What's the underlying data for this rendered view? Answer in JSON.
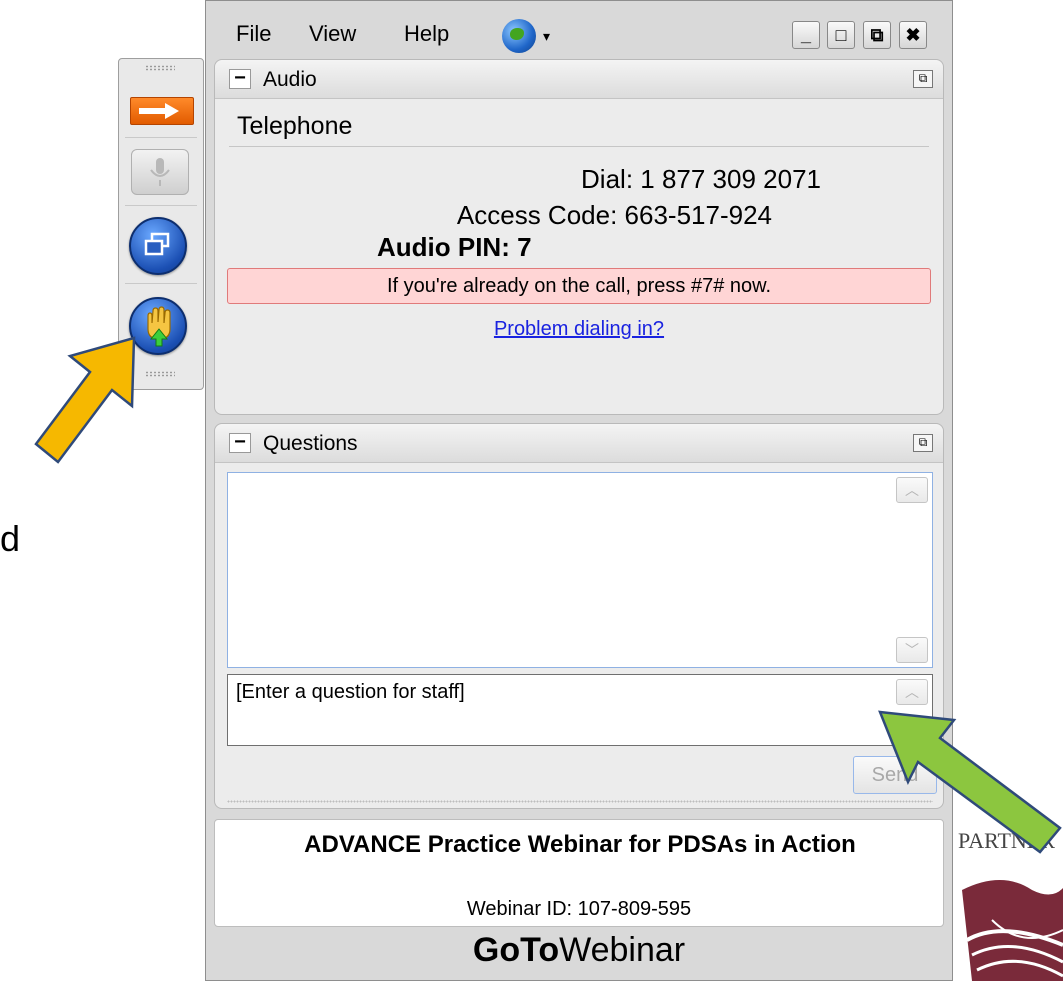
{
  "slide_fragment": "d",
  "menu": {
    "file": "File",
    "view": "View",
    "help": "Help",
    "globe_caret": "▾"
  },
  "window_controls": {
    "minimize": "_",
    "maximize": "□",
    "restore": "⧉",
    "close": "✖"
  },
  "audio": {
    "panel_title": "Audio",
    "collapse_glyph": "−",
    "mode": "Telephone",
    "dial": "Dial: 1 877 309 2071",
    "access_code": "Access Code: 663-517-924",
    "audio_pin": "Audio PIN: 7",
    "notice": "If you're already on the call, press #7# now.",
    "problem_link": "Problem dialing in?"
  },
  "questions": {
    "panel_title": "Questions",
    "collapse_glyph": "−",
    "input_placeholder": "[Enter a question for staff]",
    "send_label": "Send"
  },
  "webinar": {
    "title": "ADVANCE Practice Webinar for PDSAs in Action",
    "id": "Webinar ID: 107-809-595"
  },
  "brand": {
    "bold": "GoTo",
    "regular": "Webinar"
  },
  "partner_text": "PARTNER",
  "icons": {
    "toolbar": [
      "grip-icon",
      "arrow-right-icon",
      "microphone-icon",
      "restore-window-icon",
      "raise-hand-icon"
    ],
    "arrows": [
      "orange-pointer-arrow",
      "green-pointer-arrow"
    ]
  },
  "colors": {
    "orange_arrow": "#f6b800",
    "green_arrow": "#8cc63f",
    "arrow_outline": "#2f4a7a",
    "link": "#1a23e0",
    "notice_bg": "#ffd5d5"
  }
}
